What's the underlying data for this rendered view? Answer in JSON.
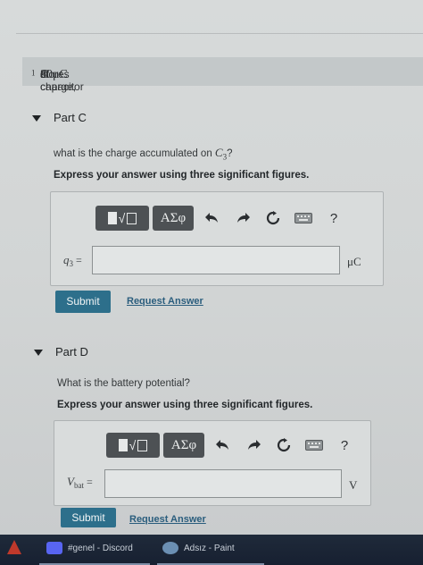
{
  "intro": {
    "prefix": "If capacitor ",
    "cap_symbol": "C",
    "cap_sub": "1",
    "middle": " stores ",
    "charge": "80μC",
    "suffix": " of charge,"
  },
  "toolbar_icons": [
    "templates-icon",
    "greek-letters-icon",
    "undo-icon",
    "redo-icon",
    "reset-icon",
    "keyboard-icon",
    "help-icon"
  ],
  "part_c": {
    "title": "Part C",
    "question_prefix": "what is the charge accumulated on ",
    "question_symbol": "C",
    "question_sub": "3",
    "question_suffix": "?",
    "instruction": "Express your answer using three significant figures.",
    "greek": "ΑΣφ",
    "help": "?",
    "var": "q",
    "var_sub": "3",
    "equals": "=",
    "input_value": "",
    "unit": "μC",
    "submit_label": "Submit",
    "request_label": "Request Answer"
  },
  "part_d": {
    "title": "Part D",
    "question": "What is the battery potential?",
    "instruction": "Express your answer using three significant figures.",
    "greek": "ΑΣφ",
    "help": "?",
    "var": "V",
    "var_sub": "bat",
    "equals": "=",
    "input_value": "",
    "unit": "V",
    "submit_label": "Submit",
    "request_label": "Request Answer"
  },
  "taskbar": {
    "items": [
      {
        "label": "#genel - Discord",
        "icon": "discord-icon",
        "color": "#5865f2"
      },
      {
        "label": "Adsız - Paint",
        "icon": "paint-icon",
        "color": "#6b8fb3"
      }
    ]
  },
  "colors": {
    "submit": "#2d6f8b",
    "link": "#2a5d7d"
  }
}
